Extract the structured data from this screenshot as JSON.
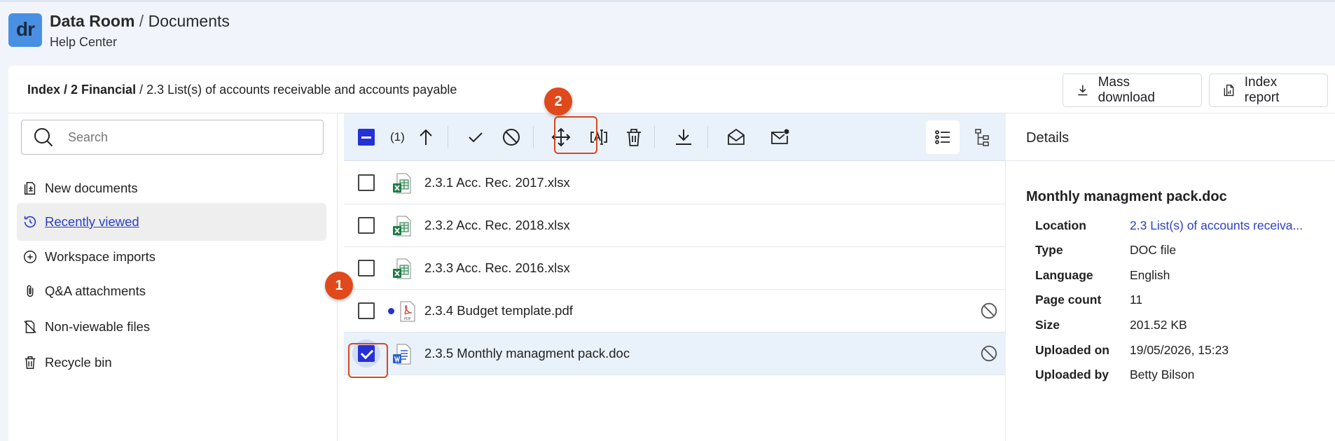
{
  "header": {
    "logo_text": "dr",
    "title_main": "Data Room",
    "title_sep": " / ",
    "title_section": "Documents",
    "subtitle": "Help Center"
  },
  "breadcrumb": {
    "part1": "Index",
    "sep1": " / ",
    "part2": "2 Financial",
    "sep2": " / ",
    "part3": "2.3 List(s) of accounts receivable and accounts payable"
  },
  "actions": {
    "mass_download": "Mass download",
    "index_report": "Index report"
  },
  "search": {
    "placeholder": "Search"
  },
  "sidebar": {
    "items": [
      {
        "label": "New documents",
        "icon": "new-documents-icon"
      },
      {
        "label": "Recently viewed",
        "icon": "history-icon",
        "active": true
      },
      {
        "label": "Workspace imports",
        "icon": "plus-circle-icon"
      },
      {
        "label": "Q&A attachments",
        "icon": "paperclip-icon"
      },
      {
        "label": "Non-viewable files",
        "icon": "file-off-icon"
      },
      {
        "label": "Recycle bin",
        "icon": "trash-icon"
      }
    ]
  },
  "toolbar": {
    "selected_count": "(1)",
    "badge_1": "1",
    "badge_2": "2",
    "buttons": [
      "upload-icon",
      "approve-icon",
      "block-icon",
      "move-icon",
      "rename-icon",
      "delete-icon",
      "download-icon",
      "mark-read-icon",
      "mark-unread-icon",
      "list-view-icon",
      "tree-view-icon"
    ]
  },
  "files": [
    {
      "name": "2.3.1 Acc. Rec. 2017.xlsx",
      "type": "xlsx",
      "checked": false,
      "unread": false,
      "blocked": false
    },
    {
      "name": "2.3.2 Acc. Rec. 2018.xlsx",
      "type": "xlsx",
      "checked": false,
      "unread": false,
      "blocked": false
    },
    {
      "name": "2.3.3 Acc. Rec. 2016.xlsx",
      "type": "xlsx",
      "checked": false,
      "unread": false,
      "blocked": false
    },
    {
      "name": "2.3.4 Budget template.pdf",
      "type": "pdf",
      "checked": false,
      "unread": true,
      "blocked": true
    },
    {
      "name": "2.3.5 Monthly managment pack.doc",
      "type": "doc",
      "checked": true,
      "unread": false,
      "blocked": true
    }
  ],
  "details": {
    "title": "Details",
    "file_name": "Monthly managment pack.doc",
    "props": [
      {
        "key": "Location",
        "value": "2.3 List(s) of accounts receiva...",
        "link": true
      },
      {
        "key": "Type",
        "value": "DOC file"
      },
      {
        "key": "Language",
        "value": "English"
      },
      {
        "key": "Page count",
        "value": "11"
      },
      {
        "key": "Size",
        "value": "201.52 KB"
      },
      {
        "key": "Uploaded on",
        "value": "19/05/2026, 15:23"
      },
      {
        "key": "Uploaded by",
        "value": "Betty Bilson"
      }
    ]
  },
  "colors": {
    "accent": "#2431d8",
    "link": "#2c3fc9",
    "highlight": "#e0491b",
    "logo_bg": "#4a90e2"
  }
}
